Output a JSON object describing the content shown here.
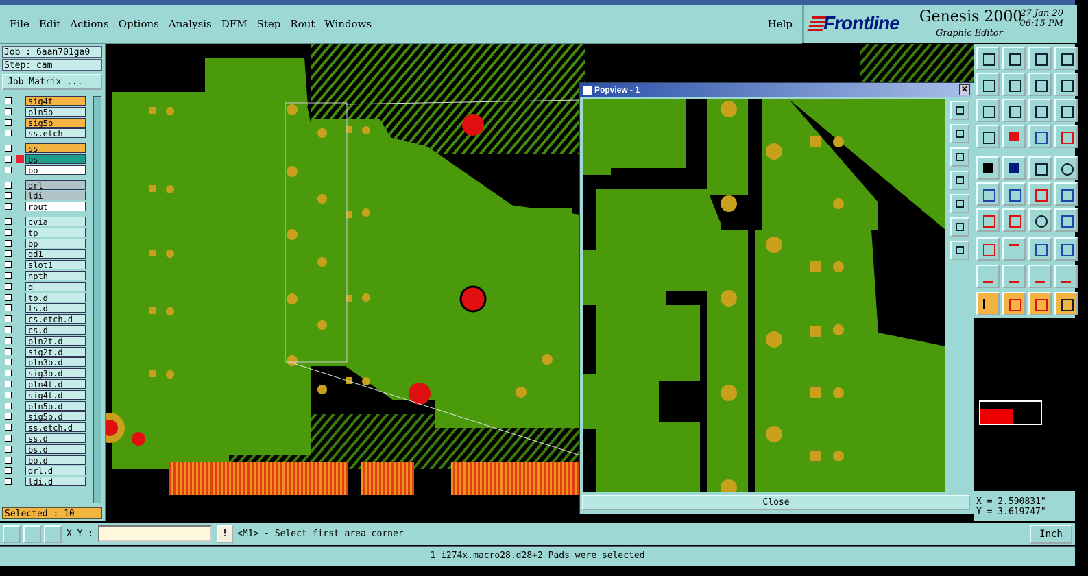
{
  "menu": {
    "items": [
      "File",
      "Edit",
      "Actions",
      "Options",
      "Analysis",
      "DFM",
      "Step",
      "Rout",
      "Windows"
    ],
    "help": "Help"
  },
  "brand": {
    "logo": "Frontline",
    "title": "Genesis 2000",
    "subtitle": "Graphic Editor",
    "date": "27 Jan 20",
    "time": "06:15 PM"
  },
  "job": {
    "job_line": "Job : 6aan701ga0",
    "step_line": "Step: cam",
    "matrix_button": "Job Matrix ..."
  },
  "layers": [
    {
      "name": "sig4t",
      "style": "sig"
    },
    {
      "name": "pln5b",
      "style": ""
    },
    {
      "name": "sig5b",
      "style": "sig"
    },
    {
      "name": "ss.etch",
      "style": ""
    },
    {
      "name": "ss",
      "style": "sig"
    },
    {
      "name": "bs",
      "style": "teal"
    },
    {
      "name": "bo",
      "style": "white"
    },
    {
      "name": "drl",
      "style": "gray"
    },
    {
      "name": "ldi",
      "style": "gray"
    },
    {
      "name": "rout",
      "style": "white"
    },
    {
      "name": "cvia",
      "style": ""
    },
    {
      "name": "tp",
      "style": ""
    },
    {
      "name": "bp",
      "style": ""
    },
    {
      "name": "gd1",
      "style": ""
    },
    {
      "name": "slot1",
      "style": ""
    },
    {
      "name": "npth",
      "style": ""
    },
    {
      "name": "d",
      "style": ""
    },
    {
      "name": "to.d",
      "style": ""
    },
    {
      "name": "ts.d",
      "style": ""
    },
    {
      "name": "cs.etch.d",
      "style": ""
    },
    {
      "name": "cs.d",
      "style": ""
    },
    {
      "name": "pln2t.d",
      "style": ""
    },
    {
      "name": "sig2t.d",
      "style": ""
    },
    {
      "name": "pln3b.d",
      "style": ""
    },
    {
      "name": "sig3b.d",
      "style": ""
    },
    {
      "name": "pln4t.d",
      "style": ""
    },
    {
      "name": "sig4t.d",
      "style": ""
    },
    {
      "name": "pln5b.d",
      "style": ""
    },
    {
      "name": "sig5b.d",
      "style": ""
    },
    {
      "name": "ss.etch.d",
      "style": ""
    },
    {
      "name": "ss.d",
      "style": ""
    },
    {
      "name": "bs.d",
      "style": ""
    },
    {
      "name": "bo.d",
      "style": ""
    },
    {
      "name": "drl.d",
      "style": ""
    },
    {
      "name": "ldi.d",
      "style": ""
    }
  ],
  "selected_count": "Selected : 10",
  "popview": {
    "title": "Popview - 1",
    "close_x": "✕",
    "close_button": "Close"
  },
  "coords": {
    "x": "X = 2.590831\"",
    "y": "Y = 3.619747\""
  },
  "command": {
    "xy_label": "X Y :",
    "xy_value": "",
    "warn": "!",
    "prompt": "<M1> - Select first area corner",
    "unit": "Inch"
  },
  "status": "1 i274x.macro28.d28+2 Pads were selected",
  "colors": {
    "copper": "#4a9a0c",
    "pad": "#c9a01c",
    "drill": "#e01010",
    "panel": "#9ed8d4",
    "highlight": "#f3b441"
  }
}
